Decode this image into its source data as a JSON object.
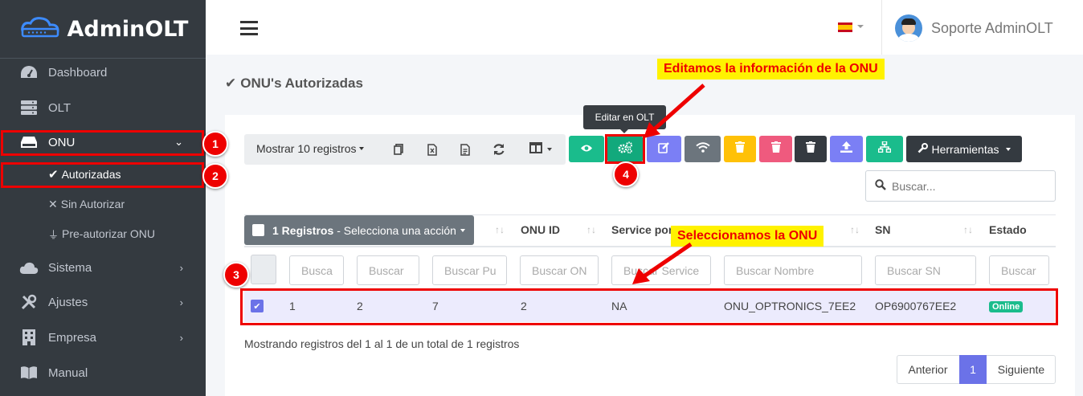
{
  "brand": {
    "name": "AdminOLT"
  },
  "sidebar": {
    "items": [
      {
        "label": "Dashboard",
        "icon": "gauge-icon"
      },
      {
        "label": "OLT",
        "icon": "server-icon"
      },
      {
        "label": "ONU",
        "icon": "hdd-icon"
      },
      {
        "label": "Sistema",
        "icon": "cloud-icon"
      },
      {
        "label": "Ajustes",
        "icon": "tools-icon"
      },
      {
        "label": "Empresa",
        "icon": "building-icon"
      },
      {
        "label": "Manual",
        "icon": "book-icon"
      }
    ],
    "subitems": [
      {
        "label": "Autorizadas",
        "icon": "check-icon"
      },
      {
        "label": "Sin Autorizar",
        "icon": "x-icon"
      },
      {
        "label": "Pre-autorizar ONU",
        "icon": "plug-icon"
      }
    ]
  },
  "header": {
    "user": "Soporte AdminOLT"
  },
  "page": {
    "title": "ONU's Autorizadas"
  },
  "toolbar": {
    "show": "Mostrar 10 registros",
    "tools": "Herramientas",
    "tooltip": "Editar en OLT",
    "colors": {
      "green": "#1abc8c",
      "purple": "#7b7ff5",
      "gray": "#6c757d",
      "yellow": "#ffc107",
      "pink": "#ef5a7e",
      "dark": "#343a40"
    }
  },
  "search": {
    "placeholder": "Buscar..."
  },
  "table": {
    "select_label": "1 Registros",
    "select_action": "- Selecciona una acción",
    "headers": [
      "ONU ID",
      "Service por",
      "SN",
      "Estado"
    ],
    "filters": [
      "Busca",
      "Buscar",
      "Buscar Pu",
      "Buscar ON",
      "Buscar Service",
      "Buscar Nombre",
      "Buscar SN",
      "Buscar"
    ],
    "row": [
      "1",
      "2",
      "7",
      "2",
      "NA",
      "ONU_OPTRONICS_7EE2",
      "OP6900767EE2"
    ],
    "status": "Online"
  },
  "pagination": {
    "info": "Mostrando registros del 1 al 1 de un total de 1 registros",
    "prev": "Anterior",
    "page": "1",
    "next": "Siguiente"
  },
  "annotations": {
    "callout_edit": "Editamos la información de la ONU",
    "callout_select": "Seleccionamos la ONU",
    "steps": [
      "1",
      "2",
      "3",
      "4"
    ]
  }
}
